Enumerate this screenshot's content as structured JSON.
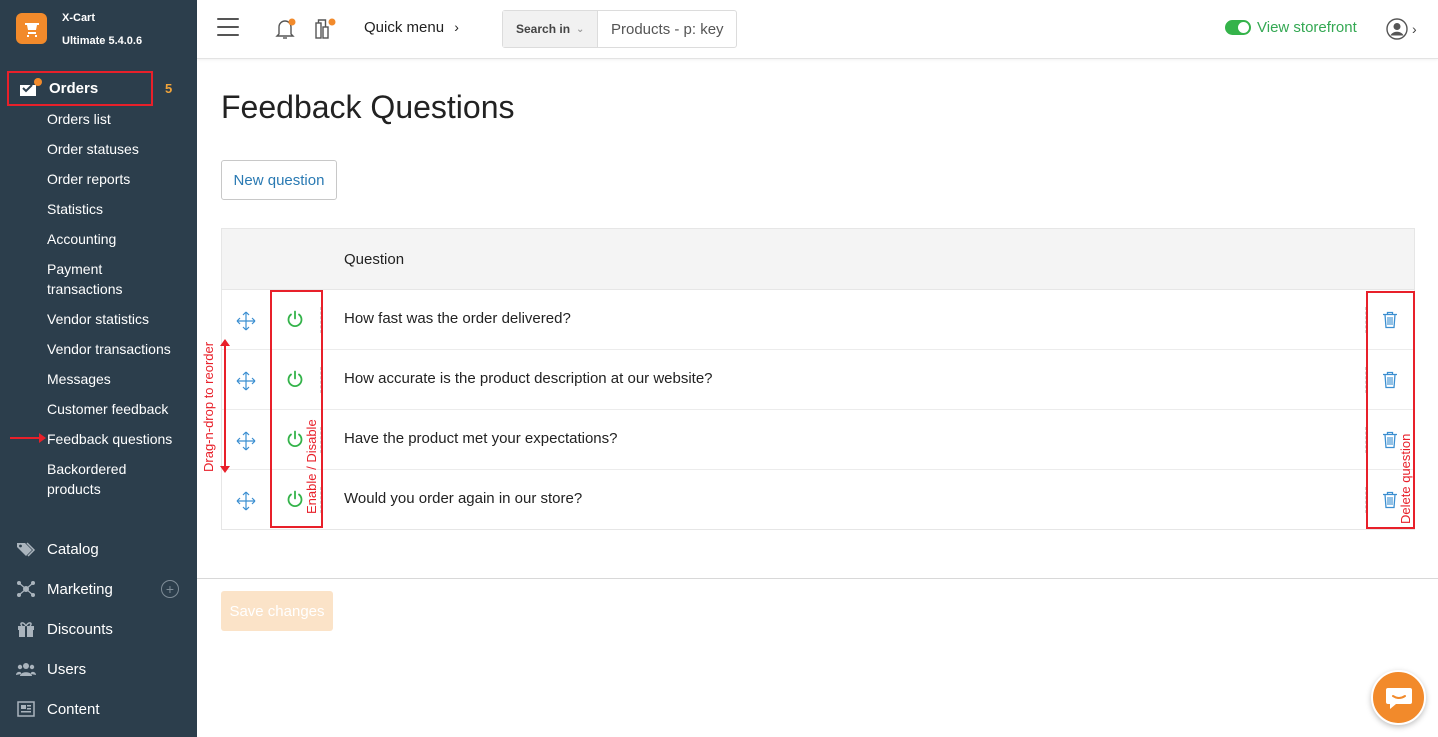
{
  "brand": {
    "name": "X-Cart",
    "version": "Ultimate 5.4.0.6"
  },
  "sidebar": {
    "orders": {
      "label": "Orders",
      "count": "5"
    },
    "order_items": [
      "Orders list",
      "Order statuses",
      "Order reports",
      "Statistics",
      "Accounting",
      "Payment transactions",
      "Vendor statistics",
      "Vendor transactions",
      "Messages",
      "Customer feedback",
      "Feedback questions",
      "Backordered products"
    ],
    "active_item": "Feedback questions",
    "nav": [
      {
        "label": "Catalog",
        "icon": "tag-icon"
      },
      {
        "label": "Marketing",
        "icon": "network-icon"
      },
      {
        "label": "Discounts",
        "icon": "gift-icon"
      },
      {
        "label": "Users",
        "icon": "users-icon"
      },
      {
        "label": "Content",
        "icon": "content-icon"
      }
    ]
  },
  "topbar": {
    "quick_menu": "Quick menu",
    "search_in": "Search in",
    "search_placeholder": "Products - p: key",
    "view_storefront": "View storefront"
  },
  "page": {
    "title": "Feedback Questions",
    "new_question": "New question",
    "column_question": "Question",
    "questions": [
      "How fast was the order delivered?",
      "How accurate is the product description at our website?",
      "Have the product met your expectations?",
      "Would you order again in our store?"
    ],
    "save_changes": "Save changes"
  },
  "annotations": {
    "drag": "Drag-n-drop to reorder",
    "enable": "Enable / Disable",
    "delete": "Delete question"
  },
  "colors": {
    "sidebar_bg": "#2c3e4c",
    "accent_orange": "#f28a2b",
    "link_blue": "#2a7ab3",
    "enabled_green": "#34b34a",
    "annotation_red": "#e8202a"
  }
}
